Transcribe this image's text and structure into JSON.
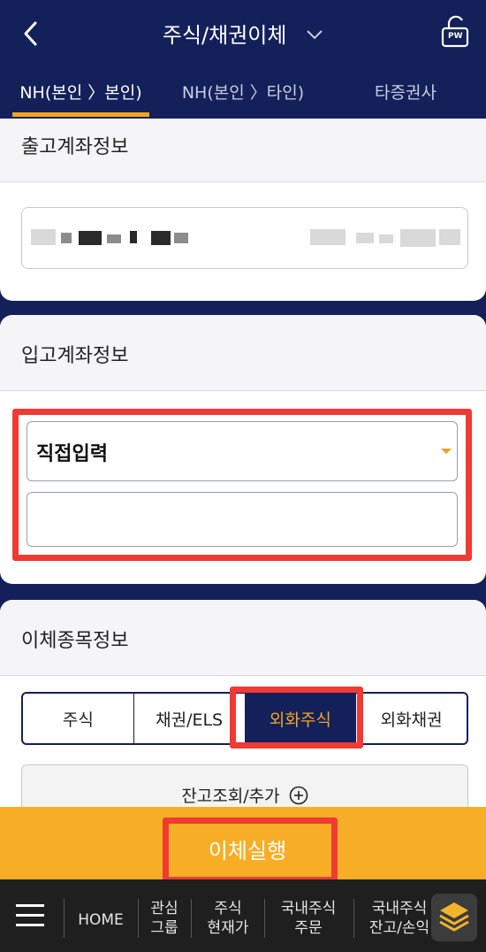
{
  "header": {
    "title": "주식/채권이체",
    "pw_label": "PW"
  },
  "tabs": [
    {
      "label": "NH(본인 〉본인)"
    },
    {
      "label": "NH(본인 〉타인)"
    },
    {
      "label": "타증권사"
    }
  ],
  "withdraw": {
    "title": "출고계좌정보"
  },
  "deposit": {
    "title": "입고계좌정보",
    "select_value": "직접입력"
  },
  "transfer_items": {
    "title": "이체종목정보",
    "segments": [
      {
        "label": "주식"
      },
      {
        "label": "채권/ELS"
      },
      {
        "label": "외화주식"
      },
      {
        "label": "외화채권"
      }
    ],
    "balance_label": "잔고조회/추가"
  },
  "execute_label": "이체실행",
  "bottom_nav": {
    "home": "HOME",
    "items": [
      {
        "l1": "관심",
        "l2": "그룹"
      },
      {
        "l1": "주식",
        "l2": "현재가"
      },
      {
        "l1": "국내주식",
        "l2": "주문"
      },
      {
        "l1": "국내주식",
        "l2": "잔고/손익"
      }
    ]
  },
  "colors": {
    "navy": "#13205a",
    "accent_orange": "#f4a51c",
    "highlight_red": "#f03a32"
  }
}
